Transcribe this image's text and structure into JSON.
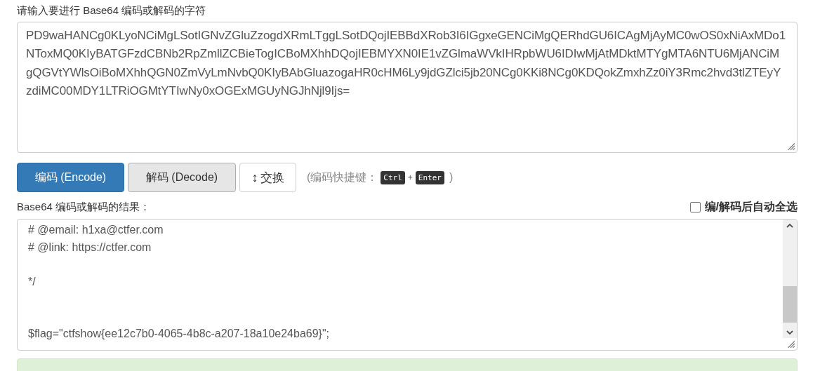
{
  "input_label": "请输入要进行 Base64 编码或解码的字符",
  "input_text": "PD9waHANCg0KLyoNCiMgLSotIGNvZGluZzogdXRmLTggLSotDQojIEBBdXRob3I6IGgxeGENCiMgQERhdGU6ICAgMjAyMC0wOS0xNiAxMDo1NToxMQ0KIyBATGFzdCBNb2RpZmllZCBieTogICBoMXhhDQojIEBMYXN0IE1vZGlmaWVkIHRpbWU6IDIwMjAtMDktMTYgMTA6NTU6MjANCiMgQGVtYWlsOiBoMXhhQGN0ZmVyLmNvbQ0KIyBAbGluazogaHR0cHM6Ly9jdGZlci5jb20NCg0KKi8NCg0KDQokZmxhZz0iY3Rmc2hvd3tlZTEyYzdiMC00MDY1LTRiOGMtYTIwNy0xOGExMGUyNGJhNjl9Ijs=",
  "buttons": [
    {
      "kind": "primary",
      "label": "编码 (Encode)"
    },
    {
      "kind": "pressed",
      "label": "解码 (Decode)"
    },
    {
      "kind": "swap",
      "icon": "↕",
      "label": "交换"
    }
  ],
  "shortcut": {
    "open": "(编码快捷键：",
    "keys": [
      "Ctrl",
      "Enter"
    ],
    "plus": "+",
    "close": ")"
  },
  "result_label": "Base64 编码或解码的结果：",
  "auto_select": {
    "label": "编/解码后自动全选",
    "checked": false
  },
  "output_text": "# @email: h1xa@ctfer.com\n# @link: https://ctfer.com\n\n*/\n\n\n$flag=\"ctfshow{ee12c7b0-4065-4b8c-a207-18a10e24ba69}\";"
}
